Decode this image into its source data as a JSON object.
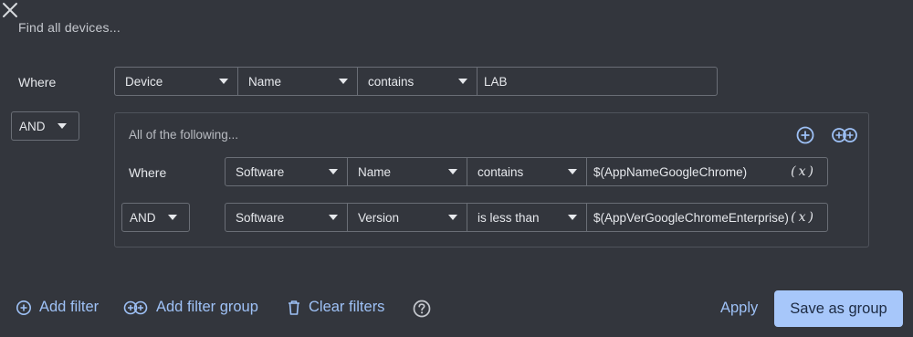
{
  "dialog": {
    "title": "Find all devices..."
  },
  "top_filter": {
    "where_label": "Where",
    "entity": "Device",
    "attribute": "Name",
    "operator": "contains",
    "value": "LAB"
  },
  "group_join": "AND",
  "group": {
    "title": "All of the following...",
    "rows": [
      {
        "label": "Where",
        "entity": "Software",
        "attribute": "Name",
        "operator": "contains",
        "value": "$(AppNameGoogleChrome)",
        "var_button": "(x)"
      },
      {
        "join": "AND",
        "entity": "Software",
        "attribute": "Version",
        "operator": "is less than",
        "value": "$(AppVerGoogleChromeEnterprise)",
        "var_button": "(x)"
      }
    ]
  },
  "footer": {
    "add_filter": "Add filter",
    "add_filter_group": "Add filter group",
    "clear_filters": "Clear filters",
    "apply": "Apply",
    "save_as_group": "Save as group"
  },
  "colors": {
    "background": "#33363d",
    "link": "#9ec1f6",
    "primary_button": "#a7c7fa",
    "border": "#6a6e76"
  },
  "icons": [
    "close-icon",
    "caret-down-icon",
    "add-circle-icon",
    "add-group-icon",
    "delete-icon",
    "help-icon"
  ]
}
